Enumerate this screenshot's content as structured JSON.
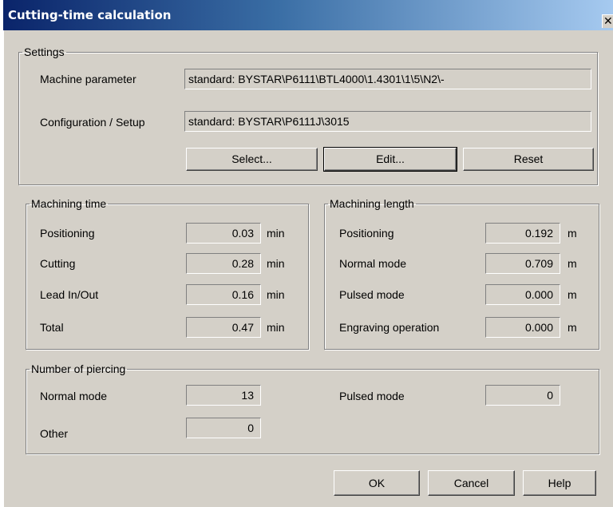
{
  "window": {
    "title": "Cutting-time calculation",
    "close_symbol": "✕"
  },
  "settings": {
    "legend": "Settings",
    "machine_parameter_label": "Machine parameter",
    "machine_parameter_value": "standard: BYSTAR\\P6111\\BTL4000\\1.4301\\1\\5\\N2\\-",
    "configuration_label": "Configuration / Setup",
    "configuration_value": "standard: BYSTAR\\P6111J\\3015",
    "select_button": "Select...",
    "edit_button": "Edit...",
    "reset_button": "Reset"
  },
  "machining_time": {
    "legend": "Machining time",
    "unit": "min",
    "rows": [
      {
        "label": "Positioning",
        "value": "0.03"
      },
      {
        "label": "Cutting",
        "value": "0.28"
      },
      {
        "label": "Lead In/Out",
        "value": "0.16"
      },
      {
        "label": "Total",
        "value": "0.47"
      }
    ]
  },
  "machining_length": {
    "legend": "Machining length",
    "unit": "m",
    "rows": [
      {
        "label": "Positioning",
        "value": "0.192"
      },
      {
        "label": "Normal mode",
        "value": "0.709"
      },
      {
        "label": "Pulsed mode",
        "value": "0.000"
      },
      {
        "label": "Engraving operation",
        "value": "0.000"
      }
    ]
  },
  "piercing": {
    "legend": "Number of piercing",
    "normal_label": "Normal mode",
    "normal_value": "13",
    "pulsed_label": "Pulsed mode",
    "pulsed_value": "0",
    "other_label": "Other",
    "other_value": "0"
  },
  "footer": {
    "ok": "OK",
    "cancel": "Cancel",
    "help": "Help"
  },
  "colors": {
    "dialog_bg": "#d4d0c8",
    "title_start": "#0a246a",
    "title_end": "#a6caf0"
  }
}
